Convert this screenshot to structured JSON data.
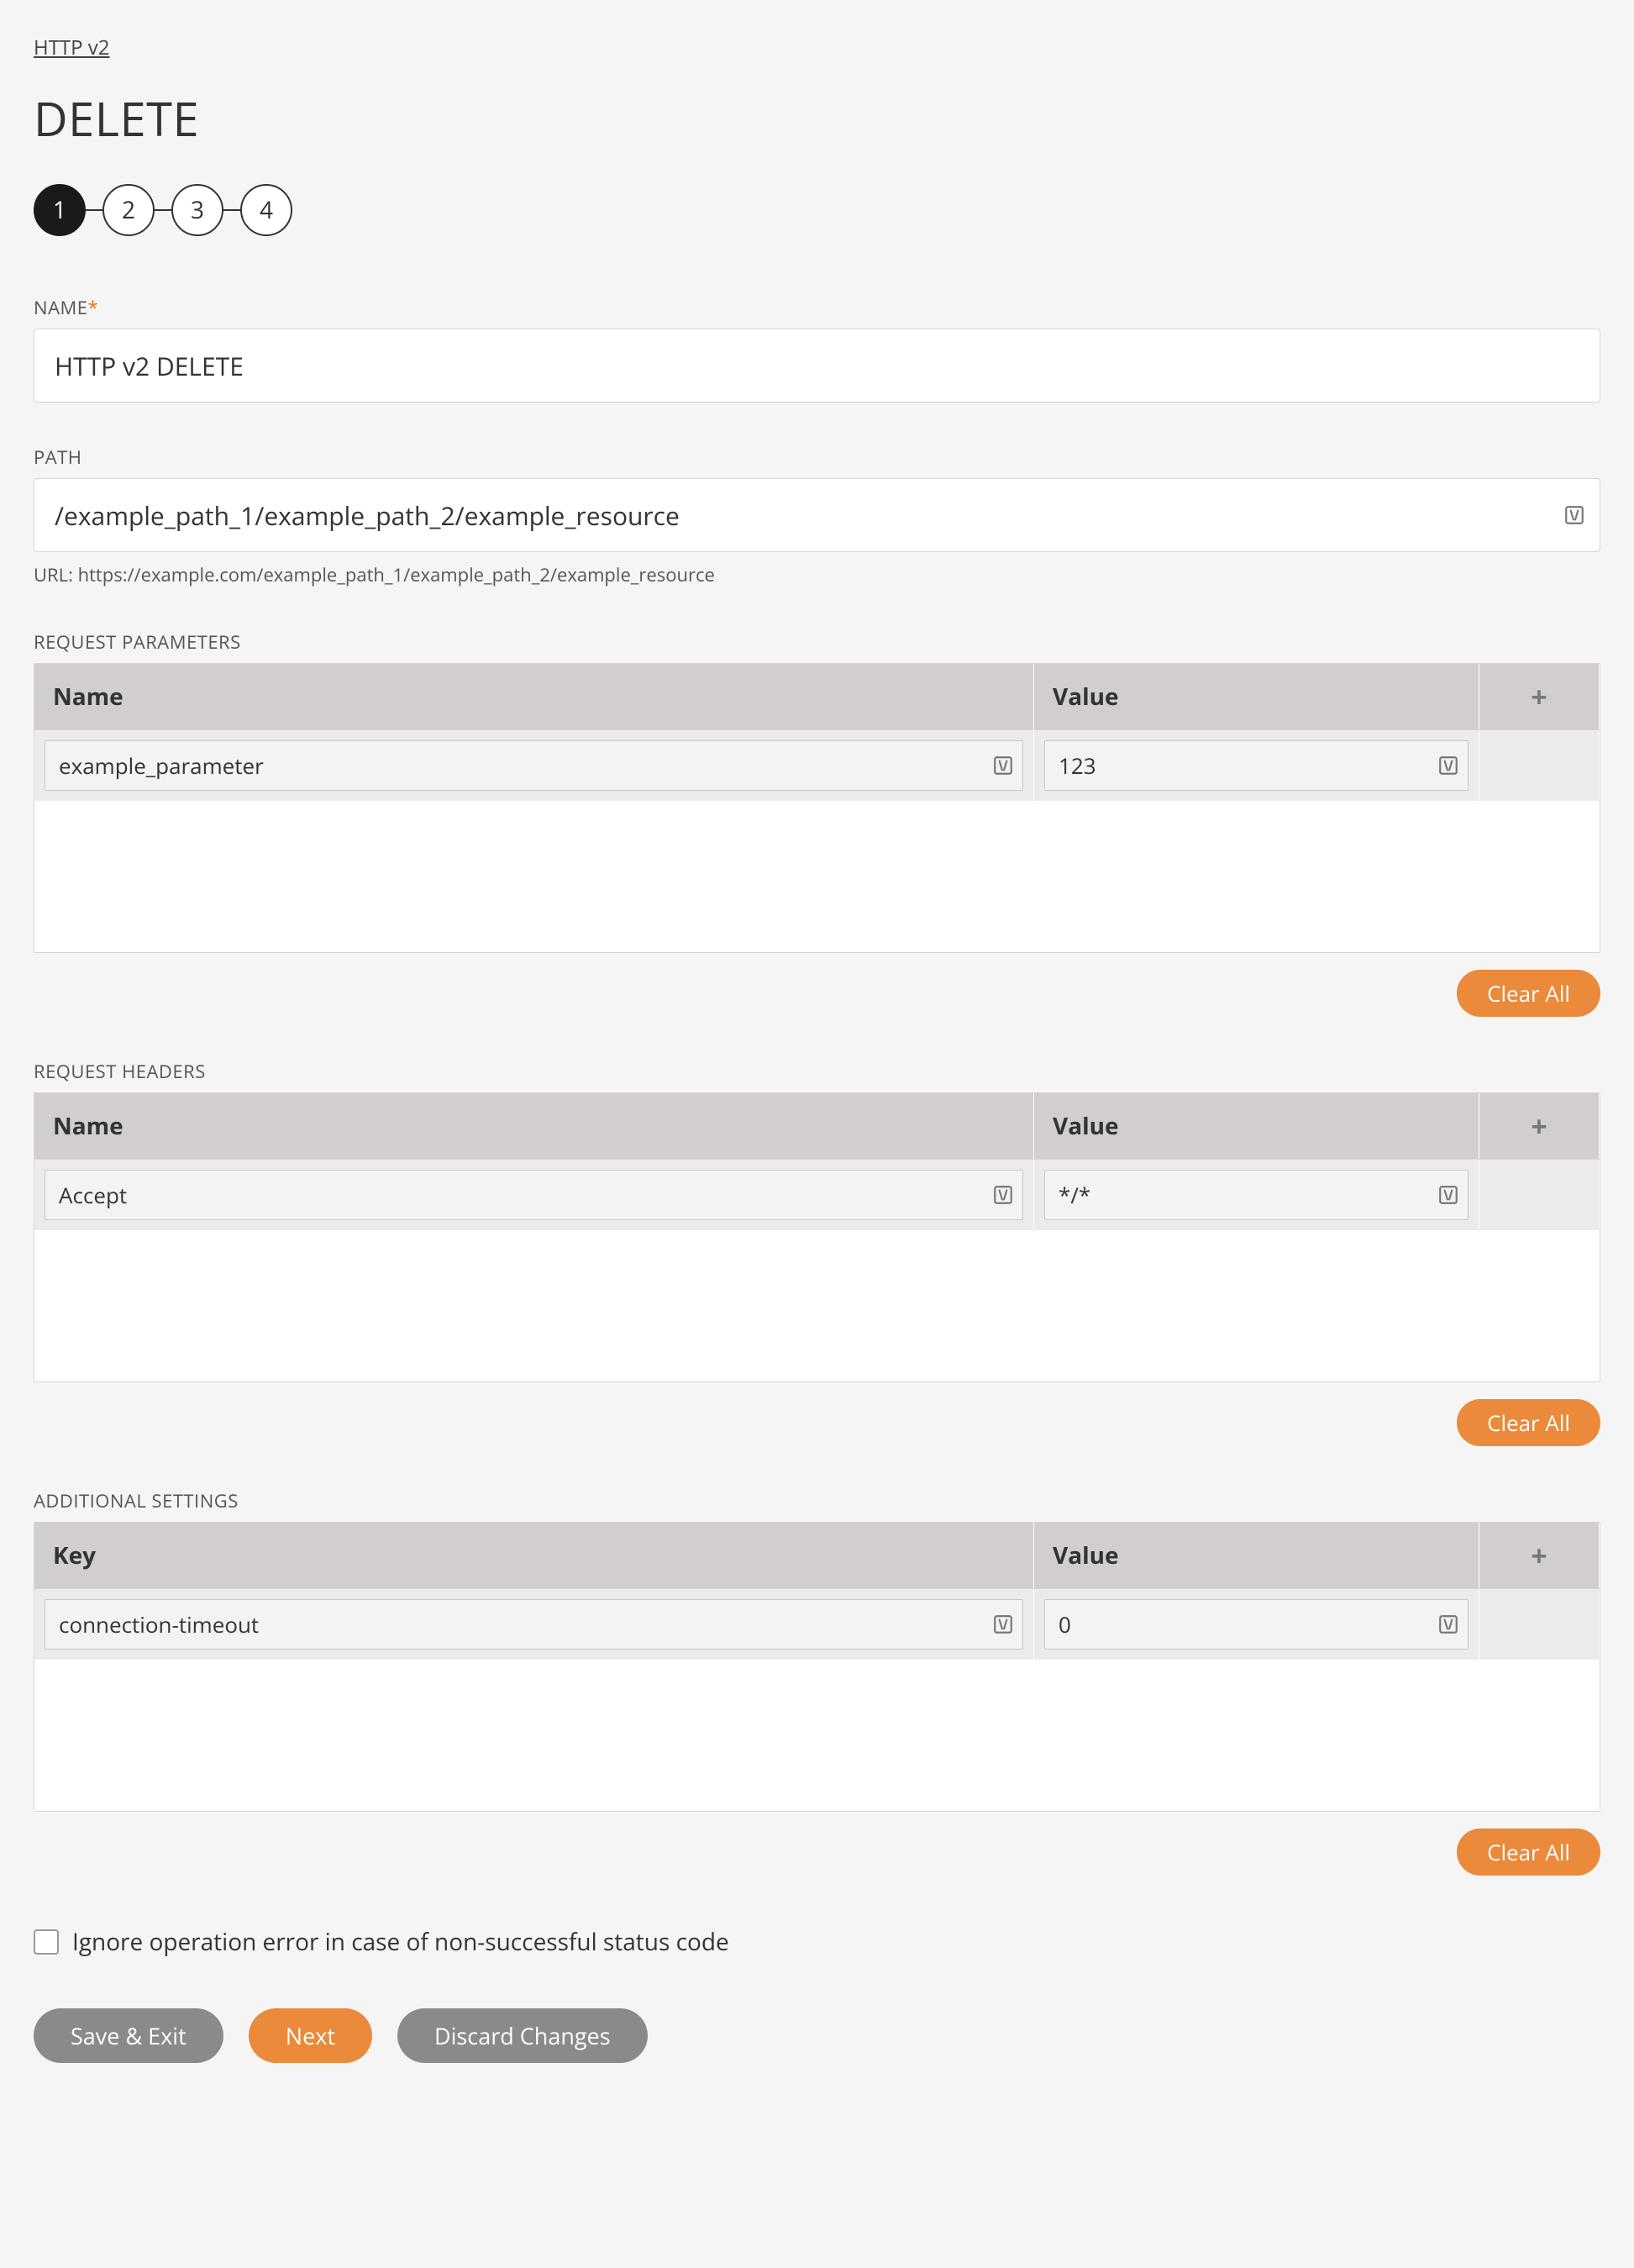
{
  "breadcrumb": "HTTP v2",
  "title": "DELETE",
  "steps": [
    "1",
    "2",
    "3",
    "4"
  ],
  "active_step": 0,
  "labels": {
    "name": "NAME",
    "path": "PATH",
    "req_params": "REQUEST PARAMETERS",
    "req_headers": "REQUEST HEADERS",
    "add_settings": "ADDITIONAL SETTINGS",
    "url_prefix": "URL: "
  },
  "fields": {
    "name_value": "HTTP v2 DELETE",
    "path_value": "/example_path_1/example_path_2/example_resource",
    "url_full": "https://example.com/example_path_1/example_path_2/example_resource"
  },
  "columns": {
    "name": "Name",
    "value": "Value",
    "key": "Key"
  },
  "params": [
    {
      "name": "example_parameter",
      "value": "123"
    }
  ],
  "headers": [
    {
      "name": "Accept",
      "value": "*/*"
    }
  ],
  "settings": [
    {
      "key": "connection-timeout",
      "value": "0"
    }
  ],
  "buttons": {
    "clear_all": "Clear All",
    "save_exit": "Save & Exit",
    "next": "Next",
    "discard": "Discard Changes"
  },
  "checkbox": {
    "ignore_error": "Ignore operation error in case of non-successful status code",
    "checked": false
  }
}
